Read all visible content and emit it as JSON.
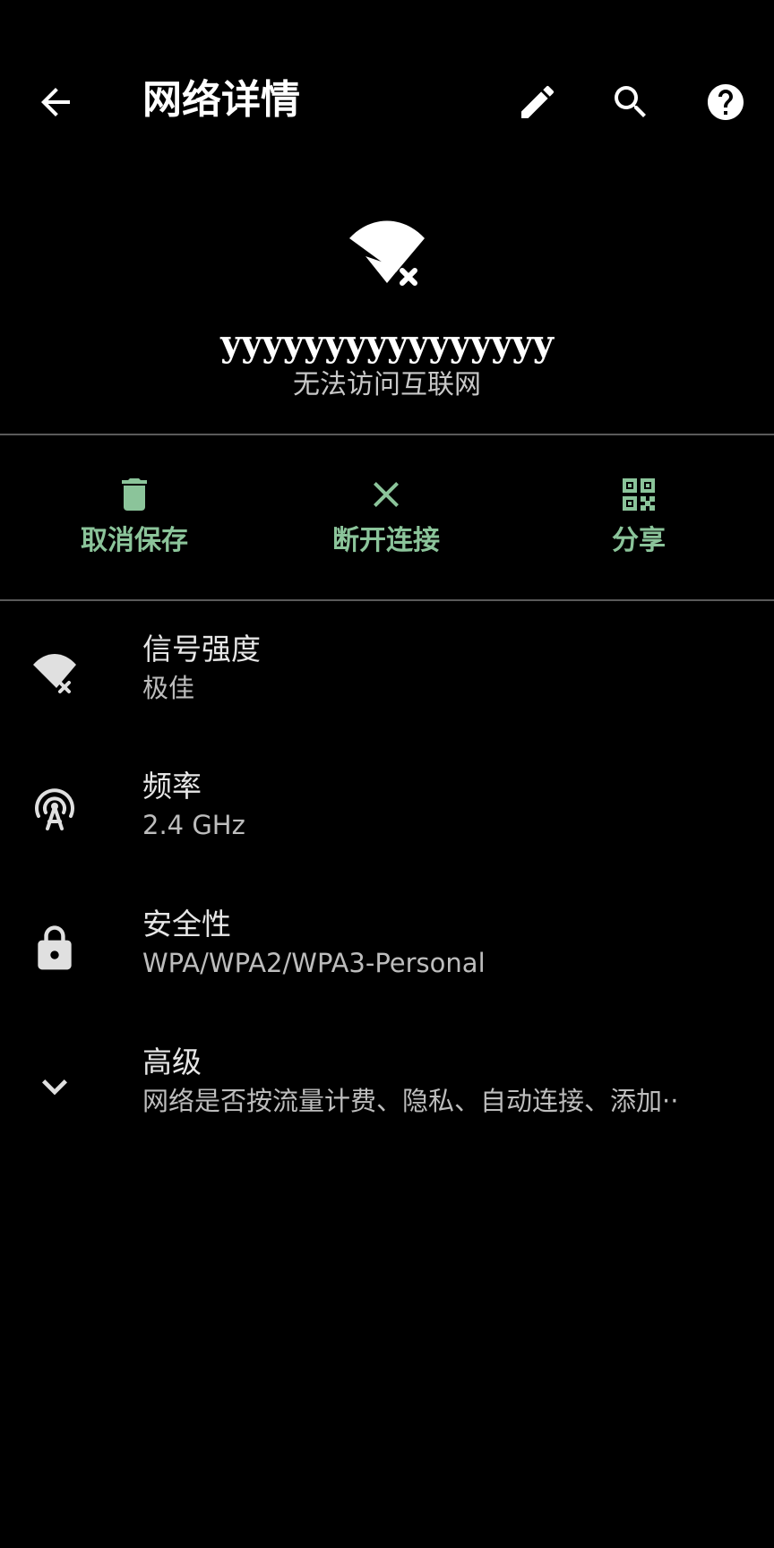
{
  "appbar": {
    "title": "网络详情",
    "icons": [
      "back-arrow-icon",
      "pencil-icon",
      "search-icon",
      "help-icon"
    ]
  },
  "network": {
    "icon": "wifi-no-internet-icon",
    "name": "yyyyyyyyyyyyyyyy",
    "status": "无法访问互联网"
  },
  "actions": [
    {
      "label": "取消保存",
      "icon": "trash-icon"
    },
    {
      "label": "断开连接",
      "icon": "close-icon"
    },
    {
      "label": "分享",
      "icon": "qr-code-icon"
    }
  ],
  "details": [
    {
      "title": "信号强度",
      "value": "极佳",
      "icon": "wifi-signal-icon"
    },
    {
      "title": "频率",
      "value": "2.4 GHz",
      "icon": "antenna-icon"
    },
    {
      "title": "安全性",
      "value": "WPA/WPA2/WPA3-Personal",
      "icon": "lock-icon"
    },
    {
      "title": "高级",
      "value": "网络是否按流量计费、隐私、自动连接、添加··",
      "icon": "chevron-down-icon"
    }
  ],
  "colors": {
    "background": "#000000",
    "accent": "#8bc49a",
    "divider": "#5a5a5a",
    "icon": "#e0e0e0"
  }
}
